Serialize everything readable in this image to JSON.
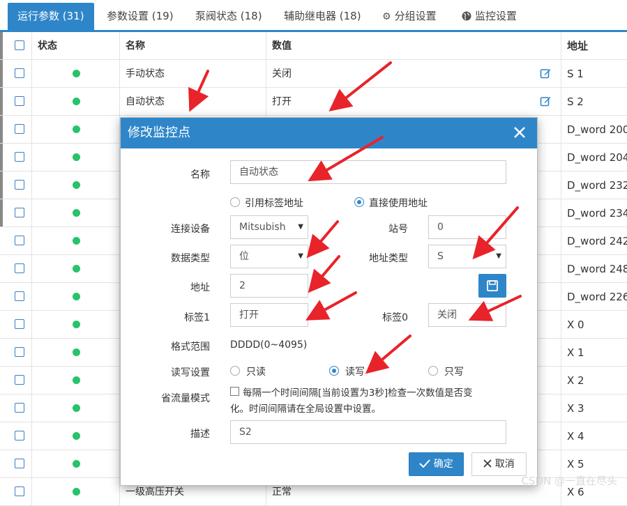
{
  "tabs": [
    {
      "label": "运行参数 (31)",
      "active": true
    },
    {
      "label": "参数设置 (19)"
    },
    {
      "label": "泵阀状态 (18)"
    },
    {
      "label": "辅助继电器 (18)"
    },
    {
      "label": "分组设置",
      "icon": "gear-icon"
    },
    {
      "label": "监控设置",
      "icon": "globe-icon"
    }
  ],
  "table": {
    "headers": {
      "status": "状态",
      "name": "名称",
      "value": "数值",
      "address": "地址"
    },
    "rows": [
      {
        "name": "手动状态",
        "value": "关闭",
        "address": "S 1",
        "editable": true
      },
      {
        "name": "自动状态",
        "value": "打开",
        "address": "S 2",
        "editable": true
      },
      {
        "address": "D_word 200"
      },
      {
        "address": "D_word 204"
      },
      {
        "address": "D_word 232"
      },
      {
        "address": "D_word 234"
      },
      {
        "address": "D_word 242"
      },
      {
        "address": "D_word 248"
      },
      {
        "address": "D_word 226"
      },
      {
        "address": "X 0"
      },
      {
        "address": "X 1"
      },
      {
        "address": "X 2"
      },
      {
        "address": "X 3"
      },
      {
        "address": "X 4"
      },
      {
        "address": "X 5"
      },
      {
        "name": "一级高压开关",
        "value": "正常",
        "address": "X 6"
      }
    ],
    "status_color": "#27c36b"
  },
  "modal": {
    "title": "修改监控点",
    "name_label": "名称",
    "name_value": "自动状态",
    "addr_mode": {
      "option1": "引用标签地址",
      "option2": "直接使用地址",
      "selected": 2
    },
    "device_label": "连接设备",
    "device_value": "Mitsubish",
    "station_label": "站号",
    "station_value": "0",
    "datatype_label": "数据类型",
    "datatype_value": "位",
    "addrtype_label": "地址类型",
    "addrtype_value": "S",
    "address_label": "地址",
    "address_value": "2",
    "tag1_label": "标签1",
    "tag1_value": "打开",
    "tag0_label": "标签0",
    "tag0_value": "关闭",
    "format_label": "格式范围",
    "format_value": "DDDD(0~4095)",
    "rw_label": "读写设置",
    "rw": {
      "readonly": "只读",
      "readwrite": "读写",
      "writeonly": "只写",
      "selected": "readwrite"
    },
    "saving_label": "省流量模式",
    "saving_text_line1": "每隔一个时间间隔[当前设置为3秒]检查一次数值是否变",
    "saving_text_line2": "化。时间间隔请在全局设置中设置。",
    "desc_label": "描述",
    "desc_value": "S2",
    "ok_label": "确定",
    "cancel_label": "取消"
  },
  "watermark": "CSDN @一直在尽头",
  "colors": {
    "accent": "#2e86c9",
    "arrow": "#e8232a"
  }
}
